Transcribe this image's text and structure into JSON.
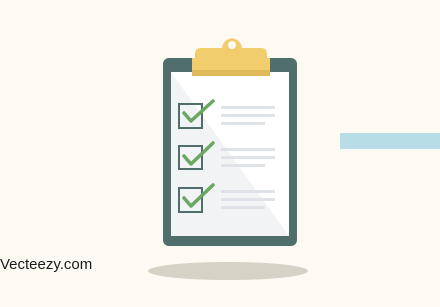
{
  "watermark": {
    "text": "Vecteezy.com"
  },
  "colors": {
    "background": "#fdfaf3",
    "board": "#4f6e6c",
    "paper": "#ffffff",
    "paper_shade": "#eef0f2",
    "clip": "#f2cd6d",
    "checkbox_border": "#4f6e6c",
    "checkmark": "#6aa862",
    "text_line": "#dfe3e7",
    "accent_bar": "#b7dde6",
    "shadow": "#d7d2c6"
  },
  "checklist": {
    "items": [
      {
        "checked": true
      },
      {
        "checked": true
      },
      {
        "checked": true
      }
    ]
  }
}
